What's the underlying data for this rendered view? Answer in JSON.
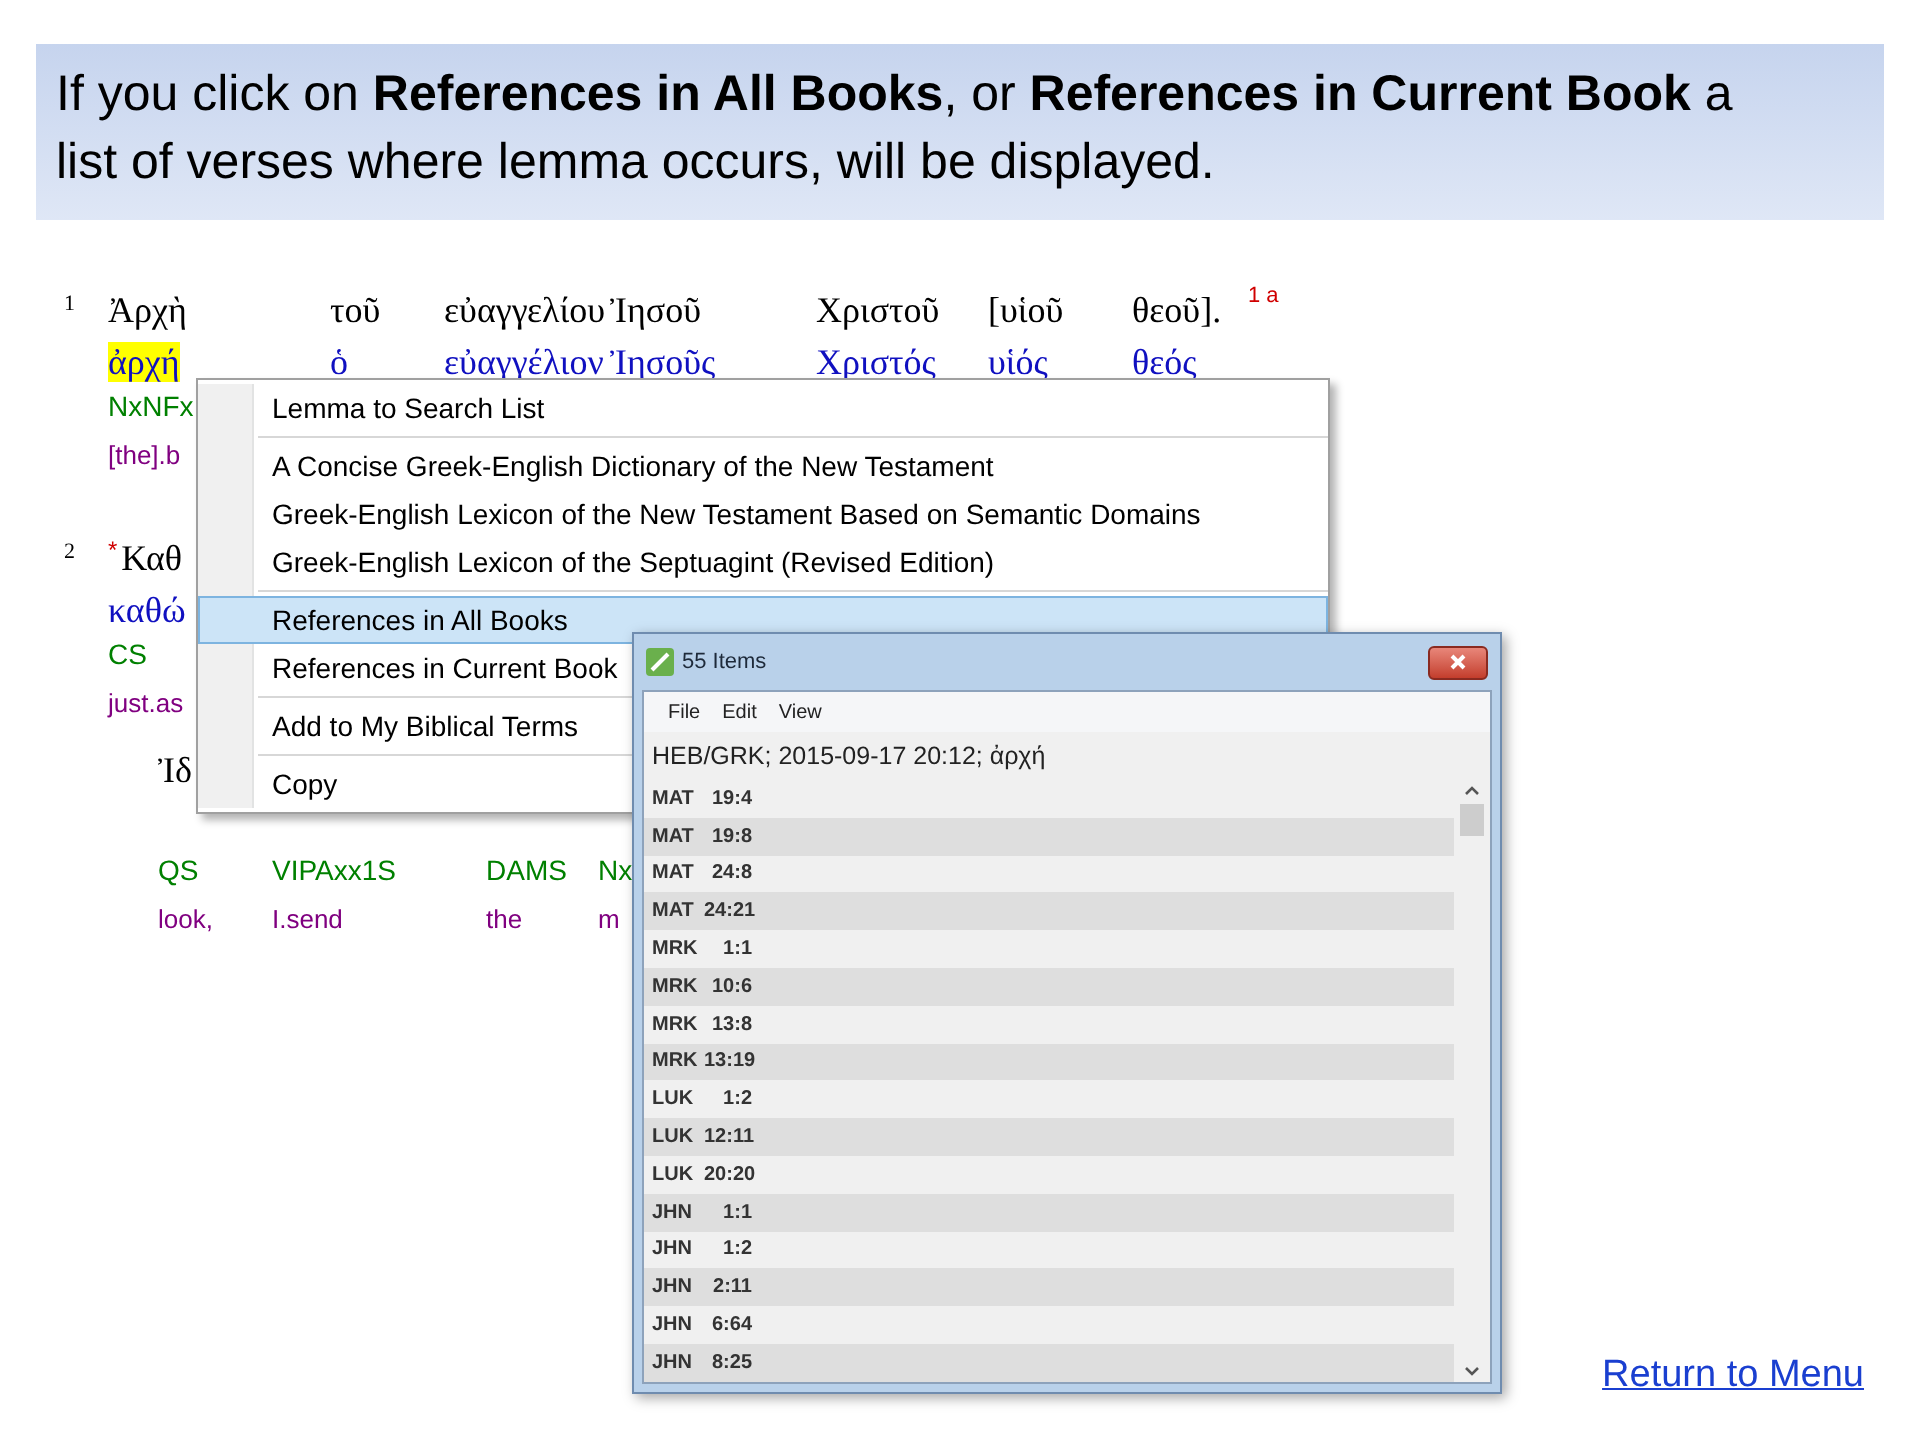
{
  "banner": {
    "text": "If you click on **References in All Books**, or **References in Current Book** a list of verses where lemma occurs, will be displayed."
  },
  "interlinear": {
    "verses": [
      {
        "number": "1",
        "footnote": "1 a",
        "lines": [
          {
            "words": [
              {
                "greek": "Ἀρχὴ",
                "lemma": "ἀρχή",
                "morph": "NxNFx",
                "gloss": "[the].b",
                "selected": true
              },
              {
                "greek": "τοῦ",
                "lemma": "ὁ",
                "selected": false
              },
              {
                "greek": "εὐαγγελίου",
                "lemma": "εὐαγγέλιον",
                "selected": false
              },
              {
                "greek": "Ἰησοῦ",
                "lemma": "Ἰησοῦς",
                "selected": false
              },
              {
                "greek": "Χριστοῦ",
                "lemma": "Χριστός",
                "selected": false
              },
              {
                "greek": "[υἱοῦ",
                "lemma": "υἱός",
                "selected": false
              },
              {
                "greek": "θεοῦ].",
                "lemma": "θεός",
                "selected": false
              }
            ]
          }
        ]
      },
      {
        "number": "2",
        "marker": "*",
        "lines": [
          {
            "words": [
              {
                "greek": "Καθ",
                "lemma": "καθώ",
                "morph": "CS",
                "gloss": "just.as",
                "selected": false
              }
            ]
          },
          {
            "words": [
              {
                "greek": "Ἰδ",
                "morph": "QS",
                "gloss": "look,"
              },
              {
                "morph": "VIPAxx1S",
                "gloss": "I.send"
              },
              {
                "morph": "DAMS",
                "gloss": "the"
              },
              {
                "morph": "Nx",
                "gloss": "m"
              }
            ]
          }
        ]
      }
    ]
  },
  "context_menu": {
    "groups": [
      [
        {
          "label": "Lemma to Search List",
          "selected": false
        }
      ],
      [
        {
          "label": "A Concise Greek-English Dictionary of the New Testament",
          "selected": false
        },
        {
          "label": "Greek-English Lexicon of the New Testament Based on Semantic Domains",
          "selected": false
        },
        {
          "label": "Greek-English Lexicon of the Septuagint (Revised Edition)",
          "selected": false
        }
      ],
      [
        {
          "label": "References in All Books",
          "selected": true
        },
        {
          "label": "References in Current Book",
          "selected": false
        }
      ],
      [
        {
          "label": "Add to My Biblical Terms",
          "selected": false
        }
      ],
      [
        {
          "label": "Copy",
          "selected": false
        }
      ]
    ]
  },
  "results_window": {
    "title": "55 Items",
    "menu": [
      "File",
      "Edit",
      "View"
    ],
    "query": "HEB/GRK; 2015-09-17 20:12; ἀρχή",
    "rows": [
      {
        "book": "MAT",
        "ref": "19:4"
      },
      {
        "book": "MAT",
        "ref": "19:8"
      },
      {
        "book": "MAT",
        "ref": "24:8"
      },
      {
        "book": "MAT",
        "ref": "24:21"
      },
      {
        "book": "MRK",
        "ref": "1:1"
      },
      {
        "book": "MRK",
        "ref": "10:6"
      },
      {
        "book": "MRK",
        "ref": "13:8"
      },
      {
        "book": "MRK",
        "ref": "13:19"
      },
      {
        "book": "LUK",
        "ref": "1:2"
      },
      {
        "book": "LUK",
        "ref": "12:11"
      },
      {
        "book": "LUK",
        "ref": "20:20"
      },
      {
        "book": "JHN",
        "ref": "1:1"
      },
      {
        "book": "JHN",
        "ref": "1:2"
      },
      {
        "book": "JHN",
        "ref": "2:11"
      },
      {
        "book": "JHN",
        "ref": "6:64"
      },
      {
        "book": "JHN",
        "ref": "8:25"
      }
    ]
  },
  "link": "Return to Menu"
}
